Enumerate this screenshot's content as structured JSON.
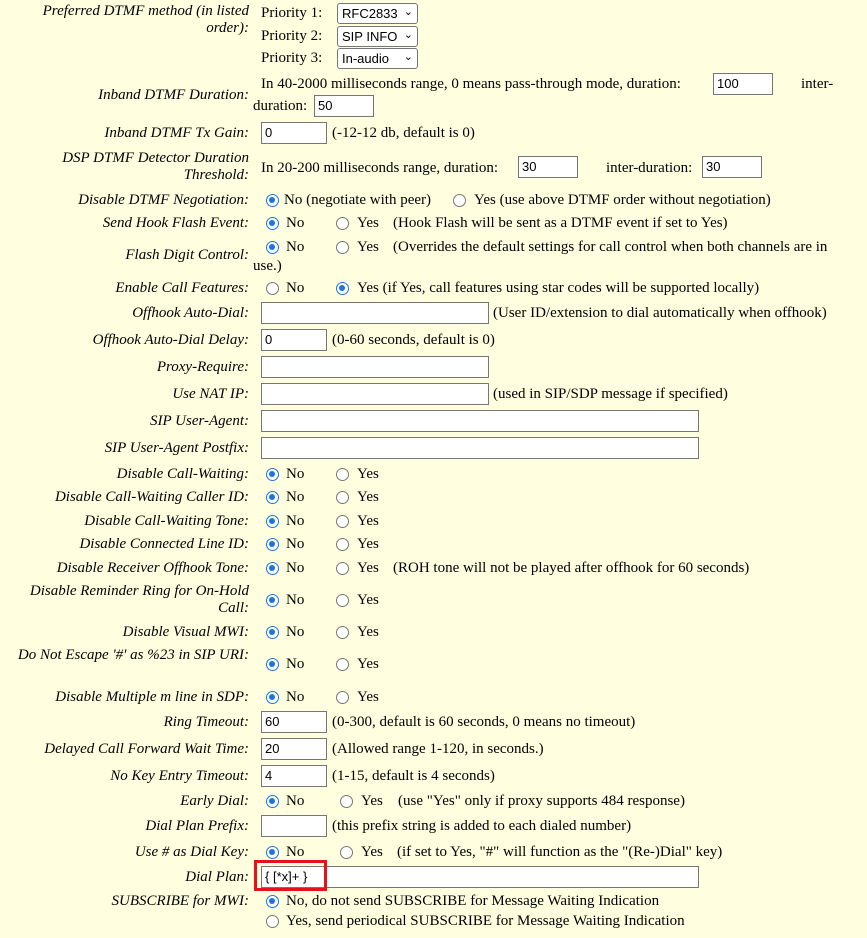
{
  "dtmf_method": {
    "label": "Preferred DTMF method (in listed order):",
    "p1_label": "Priority 1:",
    "p1_value": "RFC2833",
    "p2_label": "Priority 2:",
    "p2_value": "SIP INFO",
    "p3_label": "Priority 3:",
    "p3_value": "In-audio"
  },
  "inband_duration": {
    "label": "Inband DTMF Duration:",
    "text1": "In 40-2000 milliseconds range, 0 means pass-through mode, duration:",
    "duration": "100",
    "text2": "inter-",
    "text3": "duration:",
    "inter_duration": "50"
  },
  "inband_gain": {
    "label": "Inband DTMF Tx Gain:",
    "value": "0",
    "note": "(-12-12 db, default is 0)"
  },
  "dsp_detector": {
    "label": "DSP DTMF Detector Duration Threshold:",
    "text1": "In 20-200 milliseconds range, duration:",
    "duration": "30",
    "text2": "inter-duration:",
    "inter_duration": "30"
  },
  "disable_dtmf_neg": {
    "label": "Disable DTMF Negotiation:",
    "opt_no": "No (negotiate with peer)",
    "opt_yes": "Yes (use above DTMF order without negotiation)"
  },
  "hook_flash": {
    "label": "Send Hook Flash Event:",
    "opt_no": "No",
    "opt_yes": "Yes",
    "note": "(Hook Flash will be sent as a DTMF event if set to Yes)"
  },
  "flash_digit": {
    "label": "Flash Digit Control:",
    "opt_no": "No",
    "opt_yes": "Yes",
    "note1": "(Overrides the default settings for call control when both channels are in",
    "note2": "use.)"
  },
  "call_features": {
    "label": "Enable Call Features:",
    "opt_no": "No",
    "opt_yes": "Yes (if Yes, call features using star codes will be supported locally)"
  },
  "offhook_dial": {
    "label": "Offhook Auto-Dial:",
    "value": "",
    "note": "(User ID/extension to dial automatically when offhook)"
  },
  "offhook_delay": {
    "label": "Offhook Auto-Dial Delay:",
    "value": "0",
    "note": "(0-60 seconds, default is 0)"
  },
  "proxy_require": {
    "label": "Proxy-Require:",
    "value": ""
  },
  "nat_ip": {
    "label": "Use NAT IP:",
    "value": "",
    "note": "(used in SIP/SDP message if specified)"
  },
  "user_agent": {
    "label": "SIP User-Agent:",
    "value": ""
  },
  "user_agent_postfix": {
    "label": "SIP User-Agent Postfix:",
    "value": ""
  },
  "yes_no": {
    "no": "No",
    "yes": "Yes"
  },
  "disable_cw": {
    "label": "Disable Call-Waiting:"
  },
  "disable_cw_callerid": {
    "label": "Disable Call-Waiting Caller ID:"
  },
  "disable_cw_tone": {
    "label": "Disable Call-Waiting Tone:"
  },
  "disable_connected_id": {
    "label": "Disable Connected Line ID:"
  },
  "disable_roh": {
    "label": "Disable Receiver Offhook Tone:",
    "note": "(ROH tone will not be played after offhook for 60 seconds)"
  },
  "disable_reminder_ring": {
    "label": "Disable Reminder Ring for On-Hold Call:"
  },
  "disable_visual_mwi": {
    "label": "Disable Visual MWI:"
  },
  "no_escape": {
    "label": "Do Not Escape '#' as %23 in SIP URI:"
  },
  "disable_multi_m": {
    "label": "Disable Multiple m line in SDP:"
  },
  "ring_timeout": {
    "label": "Ring Timeout:",
    "value": "60",
    "note": "(0-300, default is 60 seconds, 0 means no timeout)"
  },
  "delayed_forward": {
    "label": "Delayed Call Forward Wait Time:",
    "value": "20",
    "note": "(Allowed range 1-120, in seconds.)"
  },
  "no_key_timeout": {
    "label": "No Key Entry Timeout:",
    "value": "4",
    "note": "(1-15, default is 4 seconds)"
  },
  "early_dial": {
    "label": "Early Dial:",
    "opt_no": "No",
    "opt_yes": "Yes",
    "note": "(use \"Yes\" only if proxy supports 484 response)"
  },
  "dial_plan_prefix": {
    "label": "Dial Plan Prefix:",
    "value": "",
    "note": "(this prefix string is added to each dialed number)"
  },
  "hash_dial_key": {
    "label": "Use # as Dial Key:",
    "opt_no": "No",
    "opt_yes": "Yes",
    "note": "(if set to Yes, \"#\" will function as the \"(Re-)Dial\" key)"
  },
  "dial_plan": {
    "label": "Dial Plan:",
    "value": "{ [*x]+ }",
    "highlight_color": "#e8101a"
  },
  "subscribe_mwi": {
    "label": "SUBSCRIBE for MWI:",
    "opt_no": "No, do not send SUBSCRIBE for Message Waiting Indication",
    "opt_yes": "Yes, send periodical SUBSCRIBE for Message Waiting Indication"
  },
  "colors": {
    "background": "#ffffe0",
    "radio_accent": "#1a73e8"
  }
}
